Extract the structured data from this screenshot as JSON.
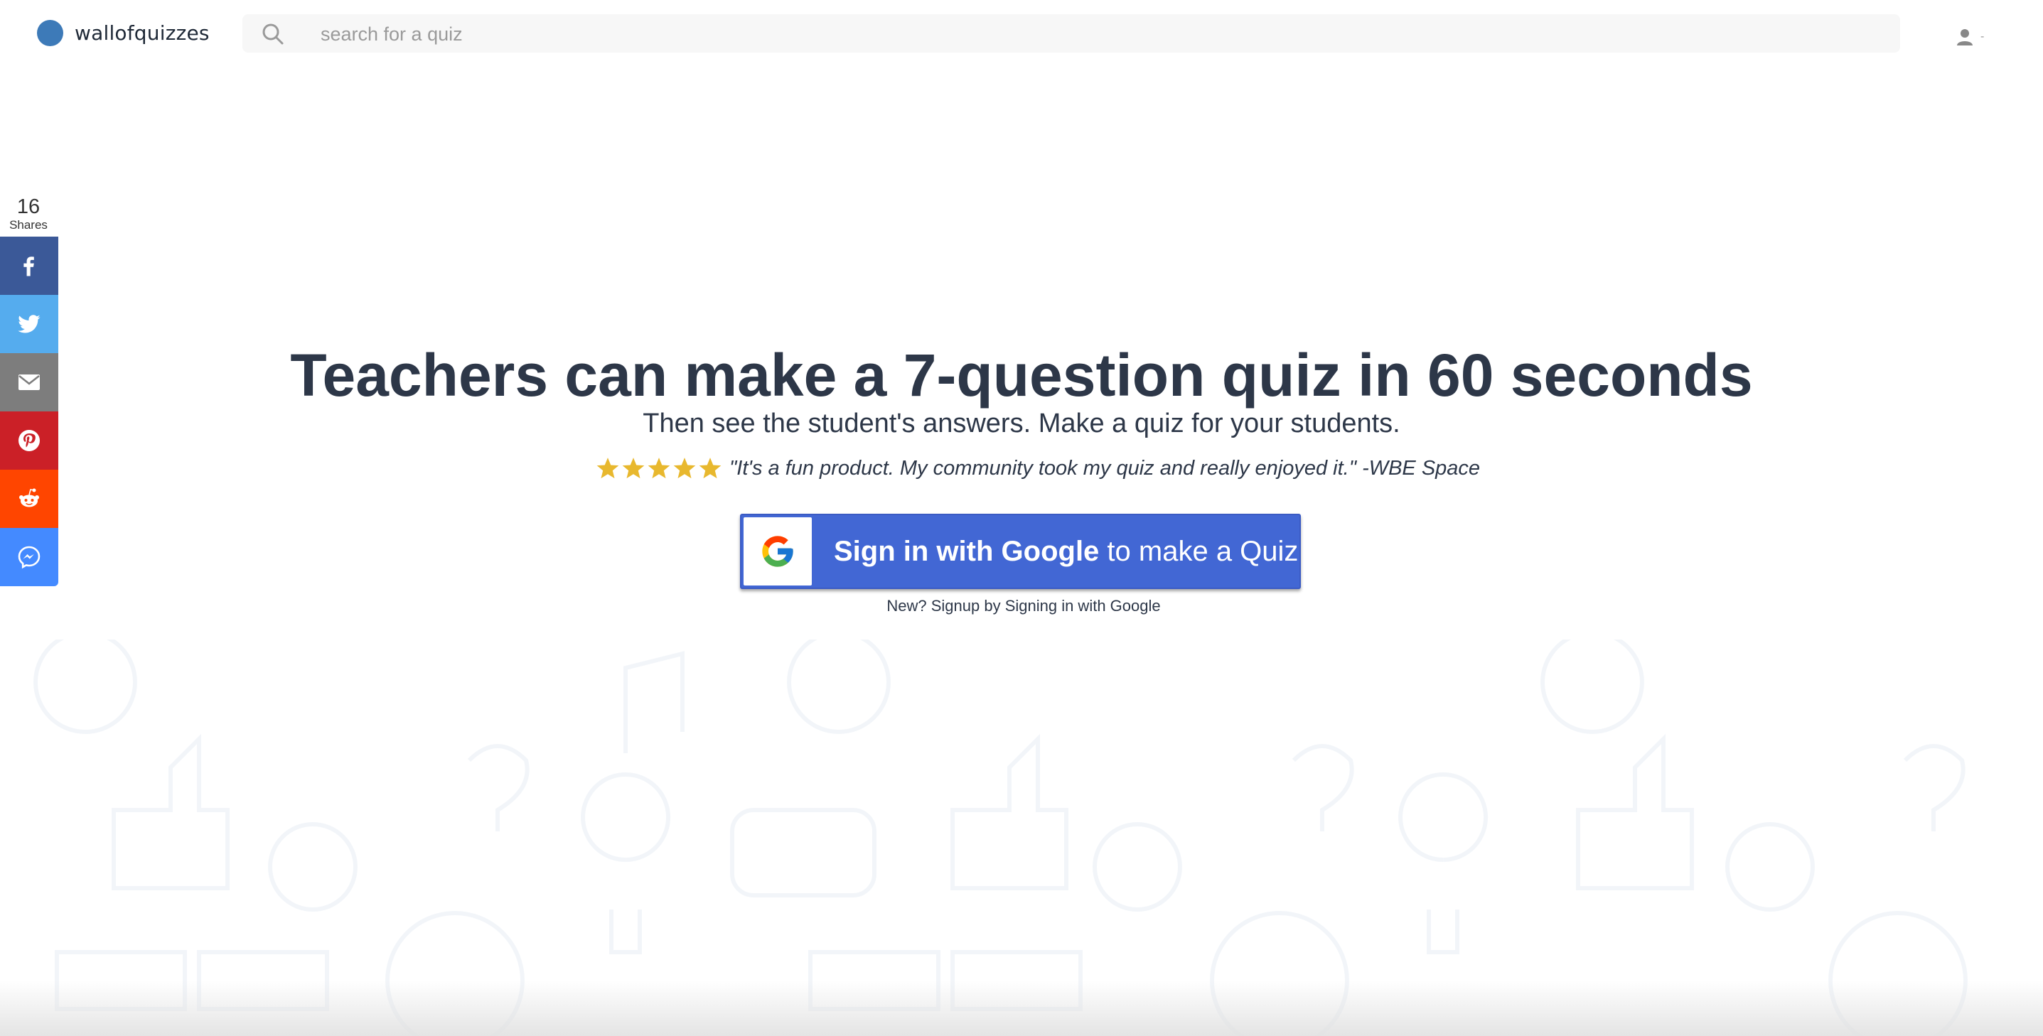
{
  "header": {
    "site_name": "wallofquizzes",
    "search_placeholder": "search for a quiz",
    "user_menu_caret": "-"
  },
  "share": {
    "count": "16",
    "label": "Shares",
    "buttons": [
      {
        "name": "facebook",
        "icon": "facebook-icon",
        "color": "#3b5998"
      },
      {
        "name": "twitter",
        "icon": "twitter-icon",
        "color": "#55acee"
      },
      {
        "name": "email",
        "icon": "email-icon",
        "color": "#7d7d7d"
      },
      {
        "name": "pinterest",
        "icon": "pinterest-icon",
        "color": "#cb2027"
      },
      {
        "name": "reddit",
        "icon": "reddit-icon",
        "color": "#ff4500"
      },
      {
        "name": "messenger",
        "icon": "messenger-icon",
        "color": "#448aff"
      }
    ]
  },
  "hero": {
    "title": "Teachers can make a 7-question quiz in 60 seconds",
    "subtitle": "Then see the student's answers. Make a quiz for your students.",
    "rating": 5,
    "star_color": "#e8b82e",
    "testimonial": "\"It's a fun product. My community took my quiz and really enjoyed it.\" -WBE Space",
    "google_button_bold": "Sign in with Google",
    "google_button_rest": " to make a Quiz",
    "google_button_color": "#4267d4",
    "signup_hint": "New? Signup by Signing in with Google"
  },
  "colors": {
    "text": "#2d3748",
    "logo_dot": "#3d7ab8",
    "search_bg": "#f7f7f7"
  }
}
